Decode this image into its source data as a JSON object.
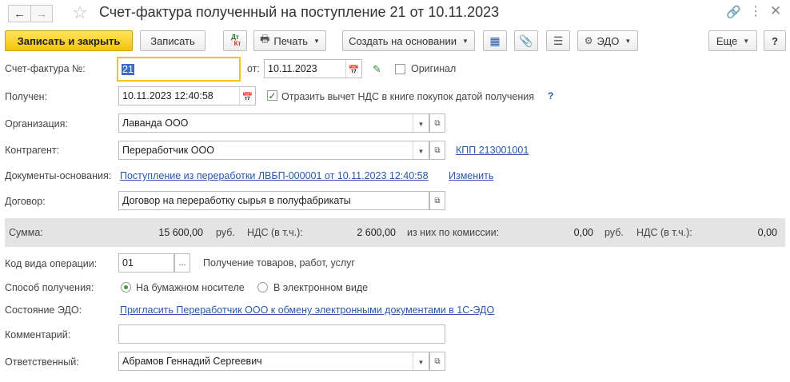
{
  "window": {
    "title": "Счет-фактура полученный на поступление 21 от 10.11.2023"
  },
  "toolbar": {
    "save_close": "Записать и закрыть",
    "save": "Записать",
    "dt_kt_top": "Дт",
    "dt_kt_bottom": "Кт",
    "print": "Печать",
    "create_based_on": "Создать на основании",
    "edo": "ЭДО",
    "more": "Еще",
    "help": "?"
  },
  "form": {
    "invoice_no_label": "Счет-фактура №:",
    "invoice_no": "21",
    "from_label": "от:",
    "invoice_date": "10.11.2023",
    "original_label": "Оригинал",
    "received_label": "Получен:",
    "received_datetime": "10.11.2023 12:40:58",
    "vat_deduct_label": "Отразить вычет НДС в книге покупок датой получения",
    "vat_help": "?",
    "org_label": "Организация:",
    "org_value": "Лаванда ООО",
    "counterparty_label": "Контрагент:",
    "counterparty_value": "Переработчик ООО",
    "kpp_link": "КПП 213001001",
    "base_docs_label": "Документы-основания:",
    "base_docs_link": "Поступление из переработки ЛВБП-000001 от 10.11.2023 12:40:58",
    "change_link": "Изменить",
    "contract_label": "Договор:",
    "contract_value": "Договор на переработку сырья в полуфабрикаты",
    "op_code_label": "Код вида операции:",
    "op_code_value": "01",
    "op_code_btn": "...",
    "op_code_desc": "Получение товаров, работ, услуг",
    "receipt_method_label": "Способ получения:",
    "paper_option": "На бумажном носителе",
    "electronic_option": "В электронном виде",
    "edo_state_label": "Состояние ЭДО:",
    "edo_invite_link": "Пригласить Переработчик ООО к обмену электронными документами в 1С-ЭДО",
    "comment_label": "Комментарий:",
    "comment_value": "",
    "responsible_label": "Ответственный:",
    "responsible_value": "Абрамов Геннадий Сергеевич"
  },
  "sums": {
    "sum_label": "Сумма:",
    "sum_value": "15 600,00",
    "currency1": "руб.",
    "vat_label1": "НДС (в т.ч.):",
    "vat_value1": "2 600,00",
    "commission_label": "из них по комиссии:",
    "commission_value": "0,00",
    "currency2": "руб.",
    "vat_label2": "НДС (в т.ч.):",
    "vat_value2": "0,00"
  },
  "colors": {
    "accent": "#f3c40c",
    "link": "#2a58a6",
    "sum_band": "#e4e4e4"
  }
}
